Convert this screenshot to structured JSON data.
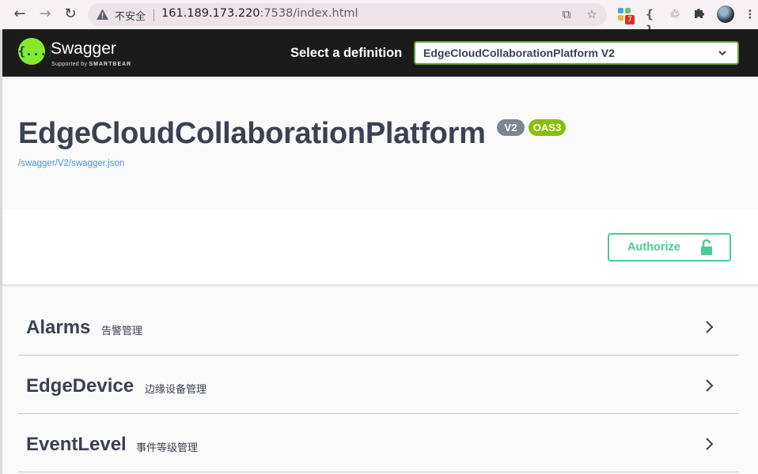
{
  "browser": {
    "insecure_label": "不安全",
    "url_host": "161.189.173.220",
    "url_rest": ":7538/index.html",
    "extension_badge": "7",
    "icons": [
      "back-icon",
      "forward-icon",
      "reload-icon",
      "warning-icon",
      "translate-icon",
      "bookmark-star-icon",
      "extension-icon",
      "json-icon",
      "recycle-icon",
      "puzzle-icon",
      "avatar",
      "menu-icon"
    ]
  },
  "topbar": {
    "logo_mark": "{...}",
    "logo_name": "Swagger",
    "logo_supported": "Supported by",
    "logo_company": "SMARTBEAR",
    "definition_label": "Select a definition",
    "definition_selected": "EdgeCloudCollaborationPlatform V2",
    "accent": "#85ea2d"
  },
  "info": {
    "title": "EdgeCloudCollaborationPlatform",
    "version_badge": "V2",
    "oas_badge": "OAS3",
    "spec_url": "/swagger/V2/swagger.json"
  },
  "auth": {
    "authorize_label": "Authorize",
    "color": "#49cc90"
  },
  "tags": [
    {
      "name": "Alarms",
      "description": "告警管理"
    },
    {
      "name": "EdgeDevice",
      "description": "边缘设备管理"
    },
    {
      "name": "EventLevel",
      "description": "事件等级管理"
    }
  ]
}
